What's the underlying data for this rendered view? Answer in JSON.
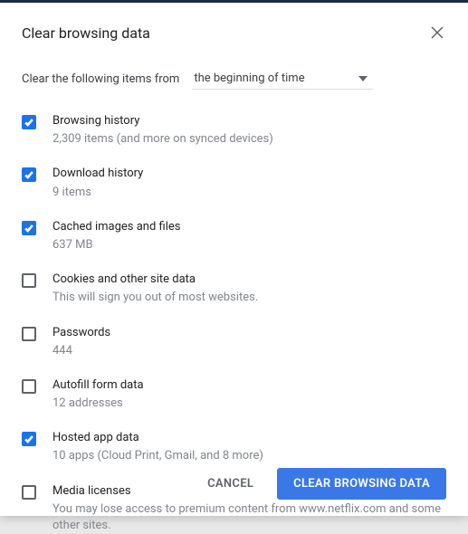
{
  "title": "Clear browsing data",
  "intro": "Clear the following items from",
  "dropdown": {
    "selected": "the beginning of time"
  },
  "options": [
    {
      "label": "Browsing history",
      "desc": "2,309 items (and more on synced devices)",
      "checked": true
    },
    {
      "label": "Download history",
      "desc": "9 items",
      "checked": true
    },
    {
      "label": "Cached images and files",
      "desc": "637 MB",
      "checked": true
    },
    {
      "label": "Cookies and other site data",
      "desc": "This will sign you out of most websites.",
      "checked": false
    },
    {
      "label": "Passwords",
      "desc": "444",
      "checked": false
    },
    {
      "label": "Autofill form data",
      "desc": "12 addresses",
      "checked": false
    },
    {
      "label": "Hosted app data",
      "desc": "10 apps (Cloud Print, Gmail, and 8 more)",
      "checked": true
    },
    {
      "label": "Media licenses",
      "desc": "You may lose access to premium content from www.netflix.com and some other sites.",
      "checked": false
    }
  ],
  "buttons": {
    "cancel": "Cancel",
    "confirm": "Clear browsing data"
  }
}
